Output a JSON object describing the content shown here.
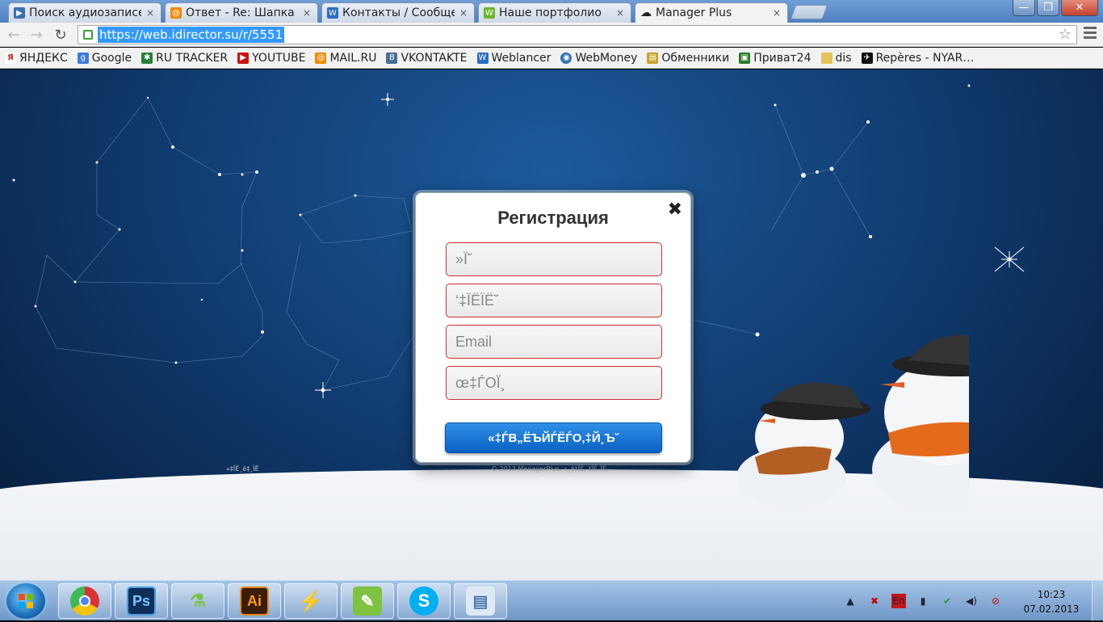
{
  "tabs": [
    {
      "title": "Поиск аудиозаписе",
      "icon": "play-icon",
      "color": "#3a6fb0"
    },
    {
      "title": "Ответ - Re: Шапка к",
      "icon": "mailru-icon",
      "color": "#f08a00"
    },
    {
      "title": "Контакты / Сообще",
      "icon": "weblancer-icon",
      "color": "#2b6cc4"
    },
    {
      "title": "Наше портфолио",
      "icon": "w-green-icon",
      "color": "#6ab82a"
    },
    {
      "title": "Manager Plus",
      "icon": "cloud-icon",
      "color": "#222222",
      "active": true
    }
  ],
  "tab_close": "×",
  "window": {
    "minimize": "—",
    "maximize": "❐",
    "close": "✕"
  },
  "toolbar": {
    "back": "←",
    "forward": "→",
    "reload": "↻",
    "url": "https://web.idirector.su/r/5551",
    "star": "☆"
  },
  "bookmarks": [
    {
      "label": "ЯНДЕКС",
      "icon": "yandex-icon",
      "color": "#d22"
    },
    {
      "label": "Google",
      "icon": "google-icon",
      "color": "#3b7be0"
    },
    {
      "label": "RU TRACKER",
      "icon": "rutracker-icon",
      "color": "#2a7d3a"
    },
    {
      "label": "YOUTUBE",
      "icon": "youtube-icon",
      "color": "#cc1111"
    },
    {
      "label": "MAIL.RU",
      "icon": "mailru-icon",
      "color": "#f08a00"
    },
    {
      "label": "VKONTAKTE",
      "icon": "vk-icon",
      "color": "#4a6c96"
    },
    {
      "label": "Weblancer",
      "icon": "weblancer-icon",
      "color": "#2b6cc4"
    },
    {
      "label": "WebMoney",
      "icon": "webmoney-icon",
      "color": "#2f6fb5"
    },
    {
      "label": "Обменники",
      "icon": "folder-doc-icon",
      "color": "#c9a12a"
    },
    {
      "label": "Приват24",
      "icon": "privat24-icon",
      "color": "#2a7a2a"
    },
    {
      "label": "dis",
      "icon": "folder-icon",
      "color": "#e7c15a"
    },
    {
      "label": "Repères - NYAR…",
      "icon": "bookmark-icon",
      "color": "#111"
    }
  ],
  "modal": {
    "title": "Регистрация",
    "close": "✖",
    "fields": [
      {
        "placeholder": "»Ї˘"
      },
      {
        "placeholder": "‘‡ЇЁЇЁ˘"
      },
      {
        "placeholder": "Email"
      },
      {
        "placeholder": "œ‡ЃОЇ¸"
      }
    ],
    "submit": "«‡ЃВ„ЁЪЙЃЁЃО‚‡Й¸Ъ˘"
  },
  "page_footer": {
    "left_text": "«‡ЇЁ¸ё‡¸ЇЁ",
    "center_text": "© 2013 ManagerPlus. «¸ё‡ЇЁ‚ ‡ЇЁ¸ЇЁ."
  },
  "taskbar": {
    "apps": [
      {
        "name": "chrome",
        "label": "",
        "icon": "chrome-icon"
      },
      {
        "name": "photoshop",
        "label": "Ps",
        "icon": "photoshop-icon",
        "color": "#1b4f8a"
      },
      {
        "name": "joxi",
        "label": "",
        "icon": "chemistry-icon"
      },
      {
        "name": "illustrator",
        "label": "Ai",
        "icon": "illustrator-icon",
        "color": "#cf7a12"
      },
      {
        "name": "winamp",
        "label": "",
        "icon": "winamp-icon"
      },
      {
        "name": "evernote",
        "label": "",
        "icon": "evernote-icon"
      },
      {
        "name": "skype",
        "label": "",
        "icon": "skype-icon"
      },
      {
        "name": "notepad",
        "label": "",
        "icon": "notepad-icon"
      }
    ],
    "language": "En",
    "time": "10:23",
    "date": "07.02.2013"
  }
}
